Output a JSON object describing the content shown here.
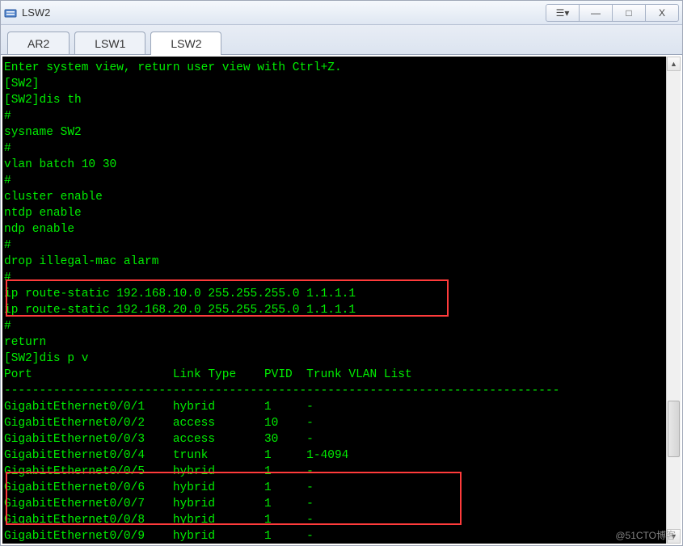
{
  "window": {
    "title": "LSW2",
    "controls": {
      "options": "☰▾",
      "minimize": "—",
      "maximize": "□",
      "close": "X"
    }
  },
  "tabs": [
    {
      "label": "AR2",
      "active": false
    },
    {
      "label": "LSW1",
      "active": false
    },
    {
      "label": "LSW2",
      "active": true
    }
  ],
  "terminal_lines": [
    "Enter system view, return user view with Ctrl+Z.",
    "[SW2]",
    "[SW2]dis th",
    "#",
    "sysname SW2",
    "#",
    "vlan batch 10 30",
    "#",
    "cluster enable",
    "ntdp enable",
    "ndp enable",
    "#",
    "drop illegal-mac alarm",
    "#",
    "ip route-static 192.168.10.0 255.255.255.0 1.1.1.1",
    "ip route-static 192.168.20.0 255.255.255.0 1.1.1.1",
    "#",
    "return",
    "[SW2]dis p v",
    "Port                    Link Type    PVID  Trunk VLAN List",
    "-------------------------------------------------------------------------------",
    "GigabitEthernet0/0/1    hybrid       1     -",
    "GigabitEthernet0/0/2    access       10    -",
    "GigabitEthernet0/0/3    access       30    -",
    "GigabitEthernet0/0/4    trunk        1     1-4094",
    "GigabitEthernet0/0/5    hybrid       1     -",
    "GigabitEthernet0/0/6    hybrid       1     -",
    "GigabitEthernet0/0/7    hybrid       1     -",
    "GigabitEthernet0/0/8    hybrid       1     -",
    "GigabitEthernet0/0/9    hybrid       1     -"
  ],
  "watermark": "@51CTO博客"
}
